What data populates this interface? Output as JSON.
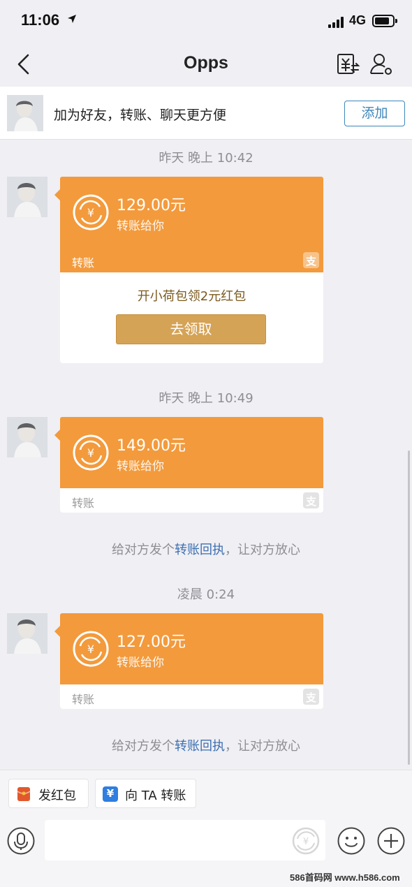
{
  "status_bar": {
    "time": "11:06",
    "network": "4G"
  },
  "nav": {
    "title": "Opps"
  },
  "banner": {
    "text": "加为好友，转账、聊天更方便",
    "add_label": "添加"
  },
  "messages": [
    {
      "time": "昨天 晚上 10:42",
      "amount": "129.00元",
      "desc": "转账给你",
      "footer": "转账",
      "promo_text": "开小荷包领2元红包",
      "promo_button": "去领取"
    },
    {
      "time": "昨天 晚上 10:49",
      "amount": "149.00元",
      "desc": "转账给你",
      "footer": "转账",
      "tip_before": "给对方发个",
      "tip_link": "转账回执",
      "tip_after": "，让对方放心"
    },
    {
      "time": "凌晨 0:24",
      "amount": "127.00元",
      "desc": "转账给你",
      "footer": "转账",
      "tip_before": "给对方发个",
      "tip_link": "转账回执",
      "tip_after": "，让对方放心"
    }
  ],
  "alipay_glyph": "支",
  "quick_actions": [
    {
      "label": "发红包",
      "icon": "red-envelope-icon",
      "color": "#e2582d"
    },
    {
      "label": "向 TA 转账",
      "icon": "transfer-icon",
      "glyph": "¥",
      "color": "#2f7ee0"
    }
  ],
  "input": {
    "placeholder": ""
  },
  "watermark": "586首码网 www.h586.com",
  "colors": {
    "card_orange": "#f39a3c",
    "link_blue": "#3d6fb0",
    "button_gold": "#d5a356"
  }
}
